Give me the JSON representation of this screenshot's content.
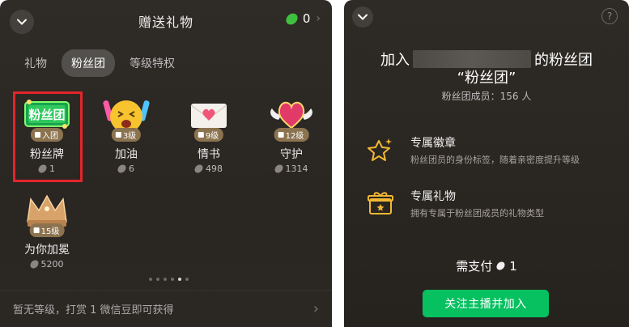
{
  "left": {
    "title": "赠送礼物",
    "balance": "0",
    "tabs": [
      {
        "label": "礼物"
      },
      {
        "label": "粉丝团"
      },
      {
        "label": "等级特权"
      }
    ],
    "gifts": [
      {
        "name": "粉丝牌",
        "level": "入团",
        "price": "1",
        "icon": "fan-badge-icon"
      },
      {
        "name": "加油",
        "level": "3级",
        "price": "6",
        "icon": "cheer-emoji-icon"
      },
      {
        "name": "情书",
        "level": "9级",
        "price": "498",
        "icon": "love-letter-icon"
      },
      {
        "name": "守护",
        "level": "12级",
        "price": "1314",
        "icon": "winged-heart-icon"
      },
      {
        "name": "为你加冕",
        "level": "15级",
        "price": "5200",
        "icon": "crown-icon"
      }
    ],
    "page_dots": 6,
    "active_dot": 4,
    "footer": "暂无等级，打赏 1 微信豆即可获得"
  },
  "right": {
    "join_prefix": "加入",
    "join_suffix": "的粉丝团",
    "club_name": "“粉丝团”",
    "members": "粉丝团成员：156 人",
    "features": [
      {
        "title": "专属徽章",
        "desc": "粉丝团员的身份标签，随着亲密度提升等级",
        "icon": "star-badge-icon"
      },
      {
        "title": "专属礼物",
        "desc": "拥有专属于粉丝团成员的礼物类型",
        "icon": "gift-box-icon"
      }
    ],
    "pay_label": "需支付",
    "pay_amount": "1",
    "join_button": "关注主播并加入",
    "help": "?"
  },
  "colors": {
    "accent_green": "#07c160",
    "selection_red": "#e3252b",
    "feature_yellow": "#f2b833",
    "level_badge": "#8c7350"
  }
}
